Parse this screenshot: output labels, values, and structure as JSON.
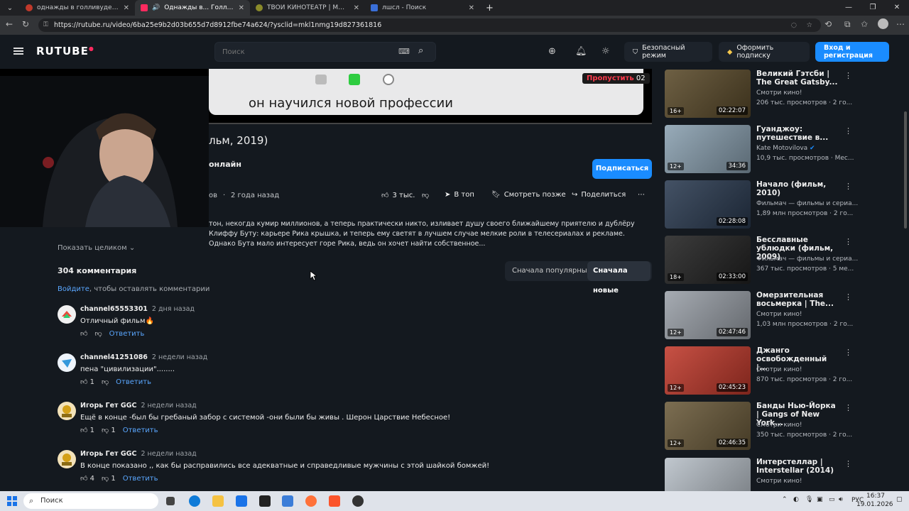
{
  "browser": {
    "tabs": [
      {
        "title": "однажды в голливуде — Яндекс",
        "color": "#c0392b"
      },
      {
        "title": "Однажды в... Голливуде (фи",
        "color": "#ff2a5f"
      },
      {
        "title": "ТВОЙ КИНОТЕАТР | MOVIE TIME",
        "color": "#8a8a2a"
      },
      {
        "title": "лшсл - Поиск",
        "color": "#3a6fd8"
      }
    ],
    "url": "https://rutube.ru/video/6ba25e9b2d03b655d7d8912fbe74a624/?ysclid=mkl1nmg19d827361816"
  },
  "header": {
    "logo": "RUTUBE",
    "search_placeholder": "Поиск",
    "safe_mode": "Безопасный режим",
    "subscribe_plan": "Оформить подписку",
    "login": "Вход и регистрация"
  },
  "player": {
    "caption": "он научился новой профессии",
    "skip_label": "Пропустить",
    "skip_count": "02"
  },
  "video": {
    "title_visible": "льм, 2019)",
    "channel_visible": "онлайн",
    "views_visible": "ов",
    "age": "2 года назад",
    "likes": "3 тыс.",
    "top": "В топ",
    "watch_later": "Смотреть позже",
    "share": "Поделиться",
    "subscribe": "Подписаться",
    "description": "тон, некогда кумир миллионов, а теперь практически никто, изливает душу своего ближайшему приятелю и дублёру Клиффу Буту: карьере Рика крышка, и теперь ему светят в лучшем случае мелкие роли в телесериалах и рекламе. Однако Бута мало интересует горе Рика, ведь он хочет найти собственное...",
    "show_more": "Показать целиком"
  },
  "comments": {
    "count_label": "304 комментария",
    "sort_popular": "Сначала популярные",
    "sort_new": "Сначала новые",
    "login_link": "Войдите",
    "login_rest": ", чтобы оставлять комментарии",
    "reply_label": "Ответить",
    "items": [
      {
        "author": "channel65553301",
        "date": "2 дня назад",
        "text": "Отличный фильм🔥",
        "likes": "",
        "dislikes": "",
        "avatar": "#e74c3c"
      },
      {
        "author": "channel41251086",
        "date": "2 недели назад",
        "text": "пена \"цивилизации\"........",
        "likes": "1",
        "dislikes": "",
        "avatar": "#3498db"
      },
      {
        "author": "Игорь Гет GGC",
        "date": "2 недели назад",
        "text": "Ещё в конце -был бы гребаный забор с системой -они были бы живы . Шерон Царствие Небесное!",
        "likes": "1",
        "dislikes": "1",
        "avatar": "#d4a017"
      },
      {
        "author": "Игорь Гет GGC",
        "date": "2 недели назад",
        "text": "В конце показано ,, как бы расправились все адекватные и справедливые мужчины с этой шайкой  бомжей!",
        "likes": "4",
        "dislikes": "1",
        "avatar": "#d4a017"
      }
    ]
  },
  "recommendations": [
    {
      "title": "Великий Гэтсби | The Great Gatsby...",
      "channel": "Смотри кино!",
      "views": "206 тыс. просмотров · 2 го...",
      "age": "16+",
      "duration": "02:22:07",
      "thumb": "#5a4a2a"
    },
    {
      "title": "Гуанджоу: путешествие в...",
      "channel": "Kate Motovilova",
      "views": "10,9 тыс. просмотров · Мес...",
      "age": "12+",
      "duration": "34:36",
      "thumb": "#8aa0b0"
    },
    {
      "title": "Начало (фильм, 2010)",
      "channel": "Фильмач — фильмы и сериа...",
      "views": "1,89 млн просмотров · 2 го...",
      "age": "",
      "duration": "02:28:08",
      "thumb": "#2a3a50"
    },
    {
      "title": "Бесславные ублюдки (фильм, 2009)",
      "channel": "Фильмач — фильмы и сериа...",
      "views": "367 тыс. просмотров · 5 ме...",
      "age": "18+",
      "duration": "02:33:00",
      "thumb": "#222"
    },
    {
      "title": "Омерзительная восьмерка | The...",
      "channel": "Смотри кино!",
      "views": "1,03 млн просмотров · 2 го...",
      "age": "12+",
      "duration": "02:47:46",
      "thumb": "#9aa0a8"
    },
    {
      "title": "Джанго освобожденный |...",
      "channel": "Смотри кино!",
      "views": "870 тыс. просмотров · 2 го...",
      "age": "12+",
      "duration": "02:45:23",
      "thumb": "#c0392b"
    },
    {
      "title": "Банды Нью-Йорка | Gangs of New York...",
      "channel": "Смотри кино!",
      "views": "350 тыс. просмотров · 2 го...",
      "age": "12+",
      "duration": "02:46:35",
      "thumb": "#6a5a3a"
    },
    {
      "title": "Интерстеллар | Interstellar (2014)",
      "channel": "Смотри кино!",
      "views": "",
      "age": "",
      "duration": "",
      "thumb": "#b8c0c8"
    }
  ],
  "taskbar": {
    "search": "Поиск",
    "lang": "РУС",
    "time": "16:37",
    "date": "19.01.2026"
  }
}
